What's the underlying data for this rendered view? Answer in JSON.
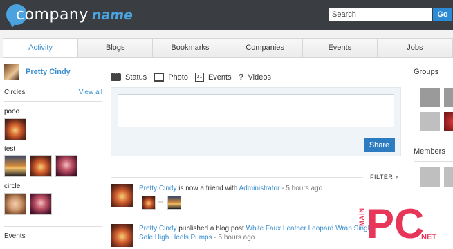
{
  "header": {
    "logo_company": "company",
    "logo_name": "name",
    "search_placeholder": "Search",
    "go_label": "Go"
  },
  "tabs": [
    "Activity",
    "Blogs",
    "Bookmarks",
    "Companies",
    "Events",
    "Jobs"
  ],
  "profile": {
    "name": "Pretty Cindy"
  },
  "circles": {
    "title": "Circles",
    "view_all": "View all",
    "groups": [
      {
        "label": "pooo"
      },
      {
        "label": "test"
      },
      {
        "label": "circle"
      }
    ]
  },
  "events_label": "Events",
  "composer": {
    "tabs": [
      "Status",
      "Photo",
      "Events",
      "Videos"
    ],
    "calendar_glyph": "31",
    "share_label": "Share"
  },
  "feed": {
    "filter_label": "FILTER",
    "items": [
      {
        "actor": "Pretty Cindy",
        "action": "is now a friend with",
        "target": "Administrator",
        "time": "5 hours ago"
      },
      {
        "actor": "Pretty Cindy",
        "action": "published a blog post",
        "target": "White Faux Leather Leopard Wrap",
        "target_cont": "Single Sole High Heels Pumps",
        "time": "5 hours ago"
      }
    ]
  },
  "right": {
    "groups_title": "Groups",
    "members_title": "Members"
  },
  "watermark": {
    "side": "MAIN",
    "big": "PC",
    "suffix": ".NET"
  },
  "colors": {
    "accent": "#3b8fd0",
    "header_bg": "#3a3e42",
    "share_btn": "#2d7cc1"
  }
}
